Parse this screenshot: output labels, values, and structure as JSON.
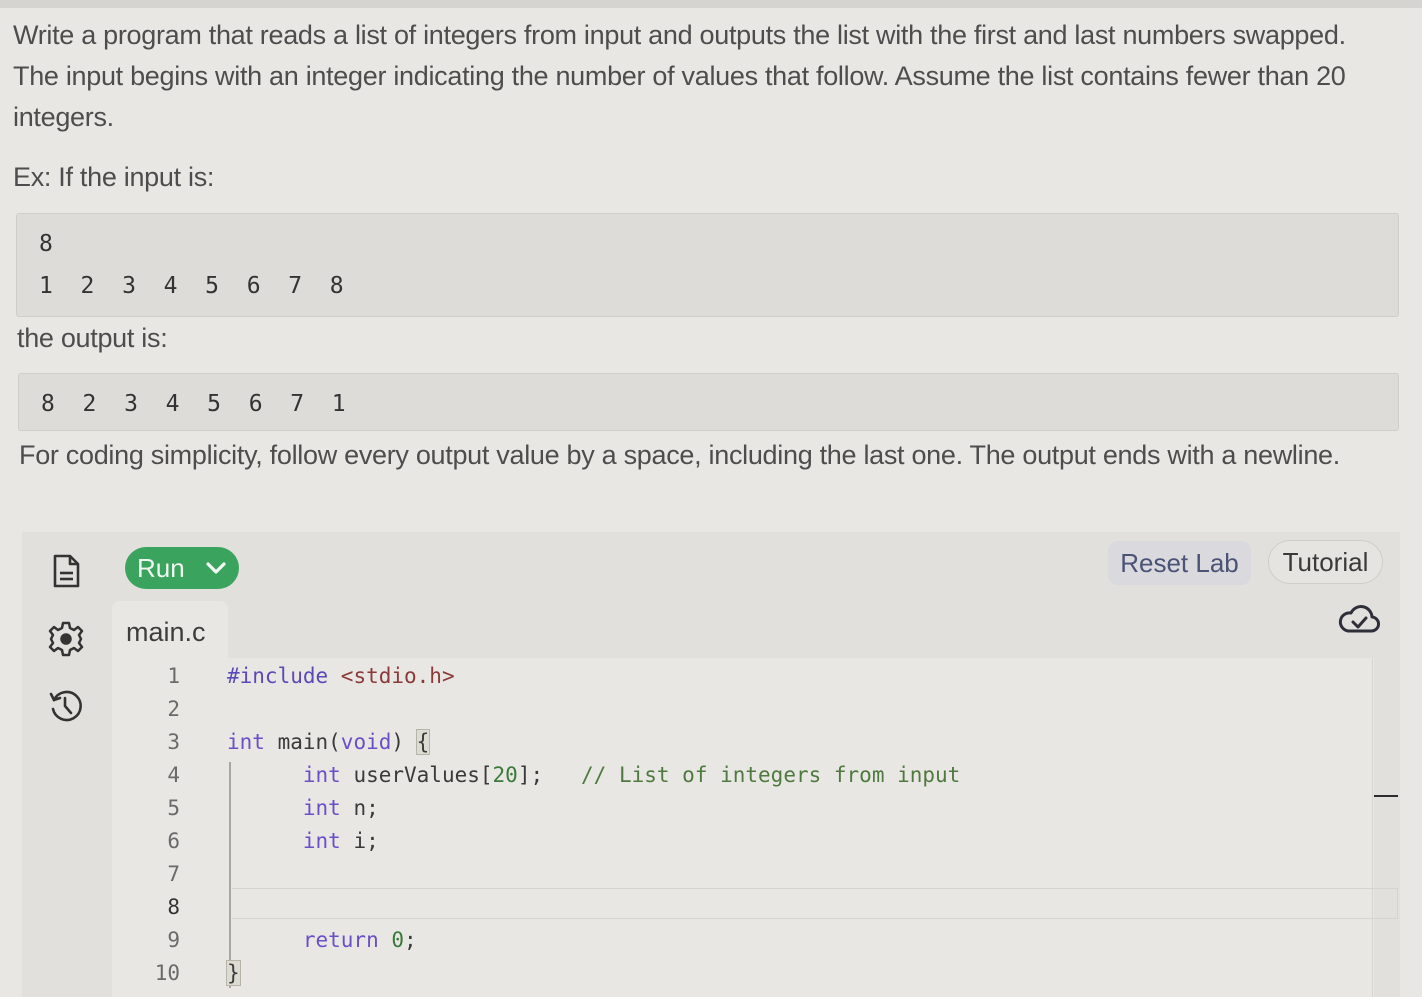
{
  "description": {
    "intro": "Write a program that reads a list of integers from input and outputs the list with the first and last numbers swapped. The input begins with an integer indicating the number of values that follow. Assume the list contains fewer than 20 integers.",
    "example_label": "Ex: If the input is:",
    "input_lines": [
      "8",
      "1 2 3 4 5 6 7 8"
    ],
    "output_label": "the output is:",
    "output_line": "8 2 3 4 5 6 7 1",
    "note": "For coding simplicity, follow every output value by a space, including the last one. The output ends with a newline."
  },
  "toolbar": {
    "run_label": "Run",
    "reset_label": "Reset Lab",
    "tutorial_label": "Tutorial"
  },
  "sidebar": {
    "icons": [
      "file-icon",
      "gear-icon",
      "history-icon"
    ]
  },
  "editor": {
    "tab_label": "main.c",
    "status_icon": "cloud-check-icon",
    "active_line": 8,
    "line_numbers": [
      "1",
      "2",
      "3",
      "4",
      "5",
      "6",
      "7",
      "8",
      "9",
      "10"
    ],
    "lines": [
      {
        "indent": "",
        "tokens": [
          {
            "t": "pp",
            "v": "#include "
          },
          {
            "t": "str",
            "v": "<stdio.h>"
          }
        ]
      },
      {
        "indent": "",
        "tokens": []
      },
      {
        "indent": "",
        "tokens": [
          {
            "t": "kw",
            "v": "int"
          },
          {
            "t": "",
            "v": " main("
          },
          {
            "t": "kw",
            "v": "void"
          },
          {
            "t": "",
            "v": ") "
          },
          {
            "t": "br",
            "v": "{"
          }
        ]
      },
      {
        "indent": "   ",
        "tokens": [
          {
            "t": "kw",
            "v": "int"
          },
          {
            "t": "",
            "v": " userValues["
          },
          {
            "t": "num",
            "v": "20"
          },
          {
            "t": "",
            "v": "];   "
          },
          {
            "t": "cm",
            "v": "// List of integers from input"
          }
        ]
      },
      {
        "indent": "   ",
        "tokens": [
          {
            "t": "kw",
            "v": "int"
          },
          {
            "t": "",
            "v": " n;"
          }
        ]
      },
      {
        "indent": "   ",
        "tokens": [
          {
            "t": "kw",
            "v": "int"
          },
          {
            "t": "",
            "v": " i;"
          }
        ]
      },
      {
        "indent": "",
        "tokens": []
      },
      {
        "indent": "",
        "tokens": []
      },
      {
        "indent": "   ",
        "tokens": [
          {
            "t": "kw",
            "v": "return"
          },
          {
            "t": "",
            "v": " "
          },
          {
            "t": "num",
            "v": "0"
          },
          {
            "t": "",
            "v": ";"
          }
        ]
      },
      {
        "indent": "",
        "tokens": [
          {
            "t": "br",
            "v": "}"
          }
        ]
      }
    ]
  }
}
